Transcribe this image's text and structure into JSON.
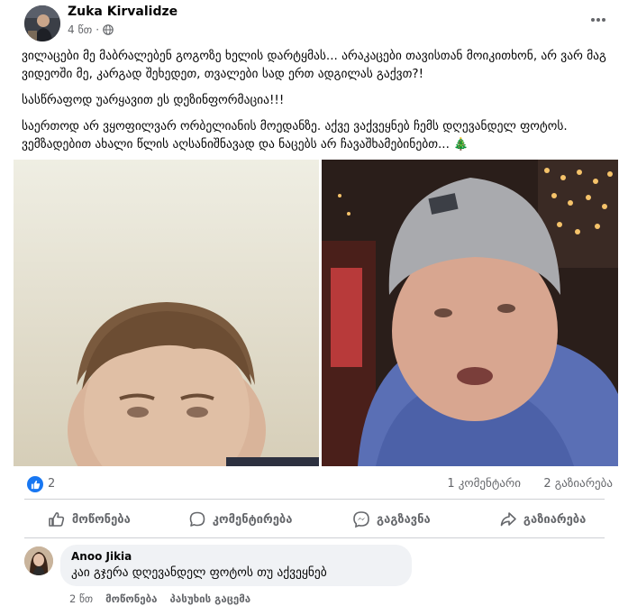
{
  "post": {
    "author": "Zuka Kirvalidze",
    "time": "4 წთ",
    "paragraphs": [
      "ვილაცები მე მაბრალებენ გოგოზე ხელის დარტყმას... არაკაცები თავისთან მოიკითხონ, არ ვარ მაგ ვიდეოში მე, კარგად შეხედეთ, თვალები სად ერთ ადგილას გაქვთ?!",
      "სასწრაფოდ უარყავით ეს დეზინფორმაცია!!!",
      "საერთოდ არ ვყოფილვარ ორბელიანის მოედანზე. აქვე ვაქვეყნებ ჩემს დღევანდელ ფოტოს. ვემზადებით ახალი წლის აღსანიშნავად და ნაცებს არ ჩავაშხამებინებთ..."
    ],
    "tree_emoji": "🎄"
  },
  "stats": {
    "likes": "2",
    "comments": "1 კომენტარი",
    "shares": "2 გაზიარება"
  },
  "actions": {
    "like": "მოწონება",
    "comment": "კომენტირება",
    "send": "გაგზავნა",
    "share": "გაზიარება"
  },
  "comment": {
    "author": "Anoo Jikia",
    "text": "კაი გჯერა დღევანდელ ფოტოს თუ აქვეყნებ",
    "time": "2 წთ",
    "like": "მოწონება",
    "reply": "პასუხის გაცემა"
  },
  "icons": {
    "globe": "globe-icon",
    "more": "more-options-icon",
    "like": "thumbs-up-icon",
    "comment": "comment-icon",
    "send": "messenger-icon",
    "share": "share-icon"
  },
  "colors": {
    "accent": "#1877f2",
    "secondary_text": "#65676b",
    "comment_bg": "#f0f2f5"
  }
}
